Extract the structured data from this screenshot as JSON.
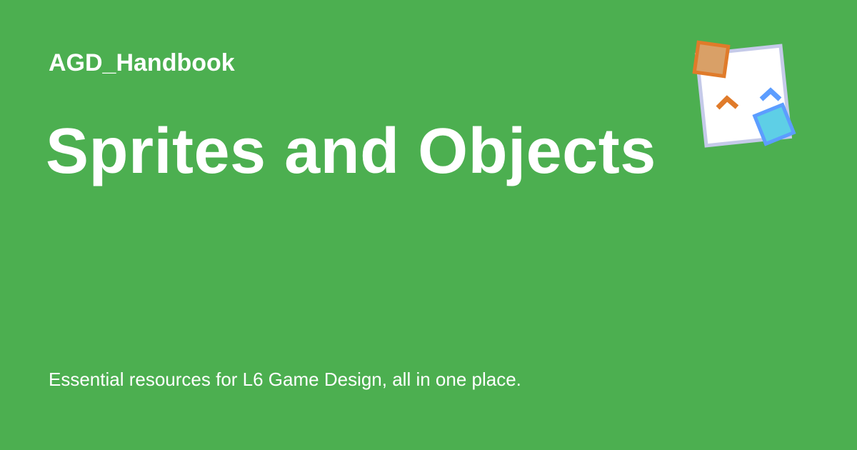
{
  "card": {
    "background_color": "#4caf50",
    "site_name": "AGD_Handbook",
    "title": "Sprites and Objects",
    "description": "Essential resources for L6 Game Design, all in one place."
  },
  "logo": {
    "icon": "sprite-frame-icon",
    "colors": {
      "frame_fill": "#ffffff",
      "frame_border": "#c5cae9",
      "orange_square_fill": "#d9a067",
      "orange_square_border": "#e07b2a",
      "orange_chevron": "#e07b2a",
      "blue_chevron": "#5c9dff",
      "cyan_square_fill": "#5ecfe6",
      "cyan_square_border": "#5c9dff"
    }
  }
}
